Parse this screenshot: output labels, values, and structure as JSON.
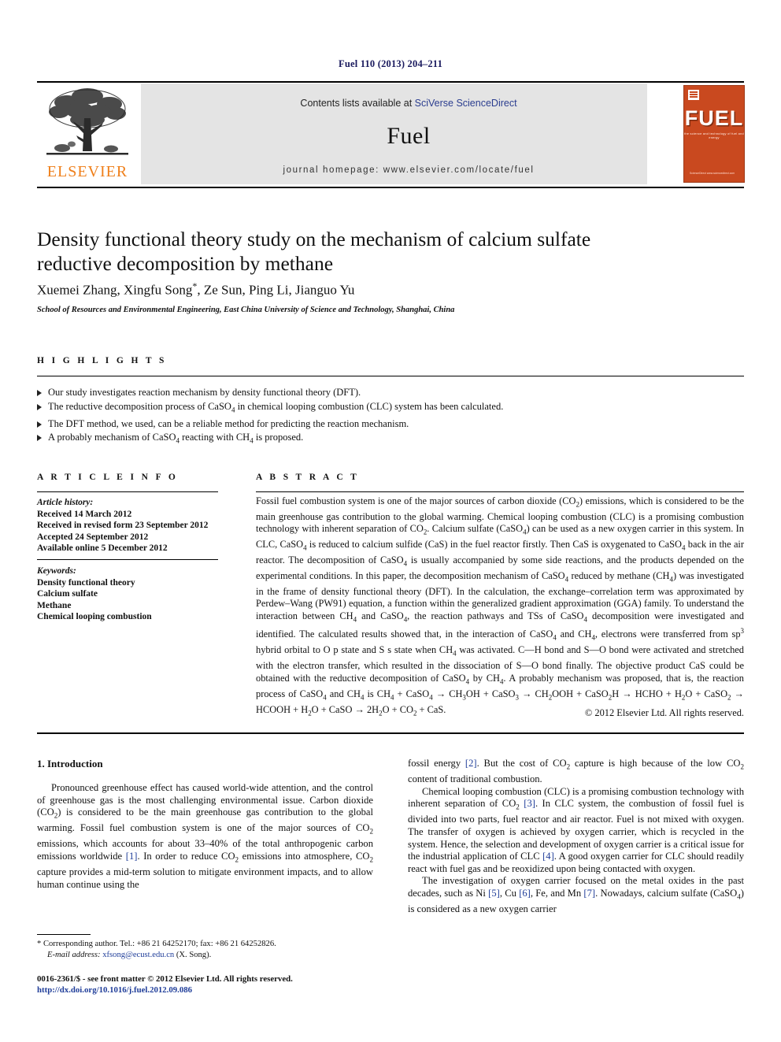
{
  "running_head": "Fuel 110 (2013) 204–211",
  "masthead": {
    "publisher_name": "ELSEVIER",
    "contents_prefix": "Contents lists available at ",
    "contents_link": "SciVerse ScienceDirect",
    "journal_title": "Fuel",
    "homepage": "journal homepage: www.elsevier.com/locate/fuel",
    "cover": {
      "title": "FUEL",
      "subtitle": "the science and technology of fuel and energy",
      "footer": "ScienceDirect  www.sciencedirect.com"
    }
  },
  "article": {
    "title_line1": "Density functional theory study on the mechanism of calcium sulfate",
    "title_line2": "reductive decomposition by methane",
    "authors": "Xuemei Zhang, Xingfu Song",
    "authors_star": "*",
    "authors_rest": ", Ze Sun, Ping Li, Jianguo Yu",
    "affiliation": "School of Resources and Environmental Engineering, East China University of Science and Technology, Shanghai, China"
  },
  "highlights": {
    "heading": "H I G H L I G H T S",
    "items": [
      "Our study investigates reaction mechanism by density functional theory (DFT).",
      "The reductive decomposition process of CaSO4 in chemical looping combustion (CLC) system has been calculated.",
      "The DFT method, we used, can be a reliable method for predicting the reaction mechanism.",
      "A probably mechanism of CaSO4 reacting with CH4 is proposed."
    ]
  },
  "article_info": {
    "heading": "A R T I C L E    I N F O",
    "history_label": "Article history:",
    "history": [
      "Received 14 March 2012",
      "Received in revised form 23 September 2012",
      "Accepted 24 September 2012",
      "Available online 5 December 2012"
    ],
    "keywords_label": "Keywords:",
    "keywords": [
      "Density functional theory",
      "Calcium sulfate",
      "Methane",
      "Chemical looping combustion"
    ]
  },
  "abstract": {
    "heading": "A B S T R A C T",
    "copyright": "© 2012 Elsevier Ltd. All rights reserved."
  },
  "introduction": {
    "heading": "1. Introduction"
  },
  "footnote": {
    "corresponding": "* Corresponding author. Tel.: +86 21 64252170; fax: +86 21 64252826.",
    "email_label": "E-mail address:",
    "email": "xfsong@ecust.edu.cn",
    "email_owner": "(X. Song)."
  },
  "colophon": {
    "line1": "0016-2361/$ - see front matter © 2012 Elsevier Ltd. All rights reserved.",
    "doi": "http://dx.doi.org/10.1016/j.fuel.2012.09.086"
  },
  "colors": {
    "runhead": "#1a1a5e",
    "elsevier_orange": "#ef7f1a",
    "link_blue": "#2b3d8f",
    "ref_blue": "#1f3d99",
    "masthead_grey": "#e4e4e4",
    "cover_red": "#c9491f"
  }
}
